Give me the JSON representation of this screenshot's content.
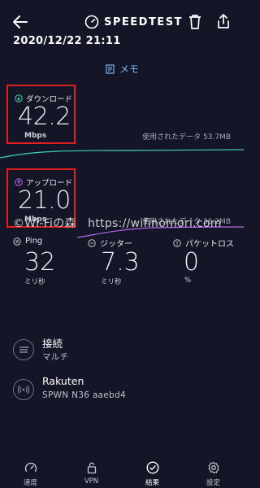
{
  "header": {
    "brand": "SPEEDTEST",
    "back_icon": "back-arrow-icon",
    "trash_icon": "trash-icon",
    "share_icon": "share-icon"
  },
  "date_time": "2020/12/22 21:11",
  "memo": {
    "label": "メモ",
    "icon": "memo-icon"
  },
  "download": {
    "label": "ダウンロード",
    "value": "42.2",
    "unit": "Mbps",
    "data_used": "使用されたデータ 53.7MB",
    "color": "#3fd0b4"
  },
  "upload": {
    "label": "アップロード",
    "value": "21.0",
    "unit": "Mbps",
    "data_used": "使用されたデータ 36.2MB",
    "color": "#b46ae8"
  },
  "watermark": "©Wi-Fiの森　https://wifinomori.com",
  "stats": {
    "ping": {
      "label": "Ping",
      "value": "32",
      "unit": "ミリ秒"
    },
    "jitter": {
      "label": "ジッター",
      "value": "7.3",
      "unit": "ミリ秒"
    },
    "packet_loss": {
      "label": "パケットロス",
      "value": "0",
      "unit": "%"
    }
  },
  "connection": {
    "title": "接続",
    "subtitle": "マルチ"
  },
  "host": {
    "title": "Rakuten",
    "subtitle": "SPWN  N36  aaebd4"
  },
  "nav": [
    {
      "label": "速度",
      "icon": "speedometer-icon",
      "active": false
    },
    {
      "label": "VPN",
      "icon": "lock-icon",
      "active": false
    },
    {
      "label": "結果",
      "icon": "check-circle-icon",
      "active": true
    },
    {
      "label": "設定",
      "icon": "gear-icon",
      "active": false
    }
  ],
  "colors": {
    "background": "#141526",
    "highlight_border": "#e0201f",
    "accent": "#7fb4ee"
  }
}
